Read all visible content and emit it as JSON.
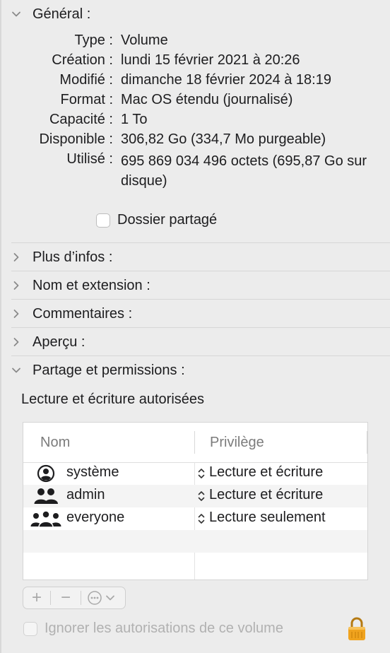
{
  "general": {
    "title": "Général :",
    "rows": [
      {
        "label": "Type :",
        "value": "Volume"
      },
      {
        "label": "Création :",
        "value": "lundi 15 février 2021 à 20:26"
      },
      {
        "label": "Modifié :",
        "value": "dimanche 18 février 2024 à 18:19"
      },
      {
        "label": "Format :",
        "value": "Mac OS étendu (journalisé)"
      },
      {
        "label": "Capacité :",
        "value": "1 To"
      },
      {
        "label": "Disponible :",
        "value": "306,82 Go (334,7 Mo purgeable)"
      },
      {
        "label": "Utilisé :",
        "value": "695 869 034 496 octets (695,87 Go sur disque)"
      }
    ],
    "shared_folder_label": "Dossier partagé",
    "shared_folder_checked": false
  },
  "sections": {
    "more_info": "Plus d’infos :",
    "name_ext": "Nom et extension :",
    "comments": "Commentaires :",
    "preview": "Aperçu :",
    "sharing": "Partage et permissions :"
  },
  "sharing": {
    "caption": "Lecture et écriture autorisées",
    "columns": {
      "name": "Nom",
      "privilege": "Privilège"
    },
    "rows": [
      {
        "icon": "person-circle-icon",
        "name": "système",
        "privilege": "Lecture et écriture"
      },
      {
        "icon": "two-people-icon",
        "name": "admin",
        "privilege": "Lecture et écriture"
      },
      {
        "icon": "three-people-icon",
        "name": "everyone",
        "privilege": "Lecture seulement"
      }
    ],
    "toolbar": {
      "add": "+",
      "remove": "−"
    },
    "ignore_label": "Ignorer les autorisations de ce volume",
    "ignore_checked": false
  },
  "colors": {
    "background": "#ececec",
    "lock": "#f0a31e"
  }
}
